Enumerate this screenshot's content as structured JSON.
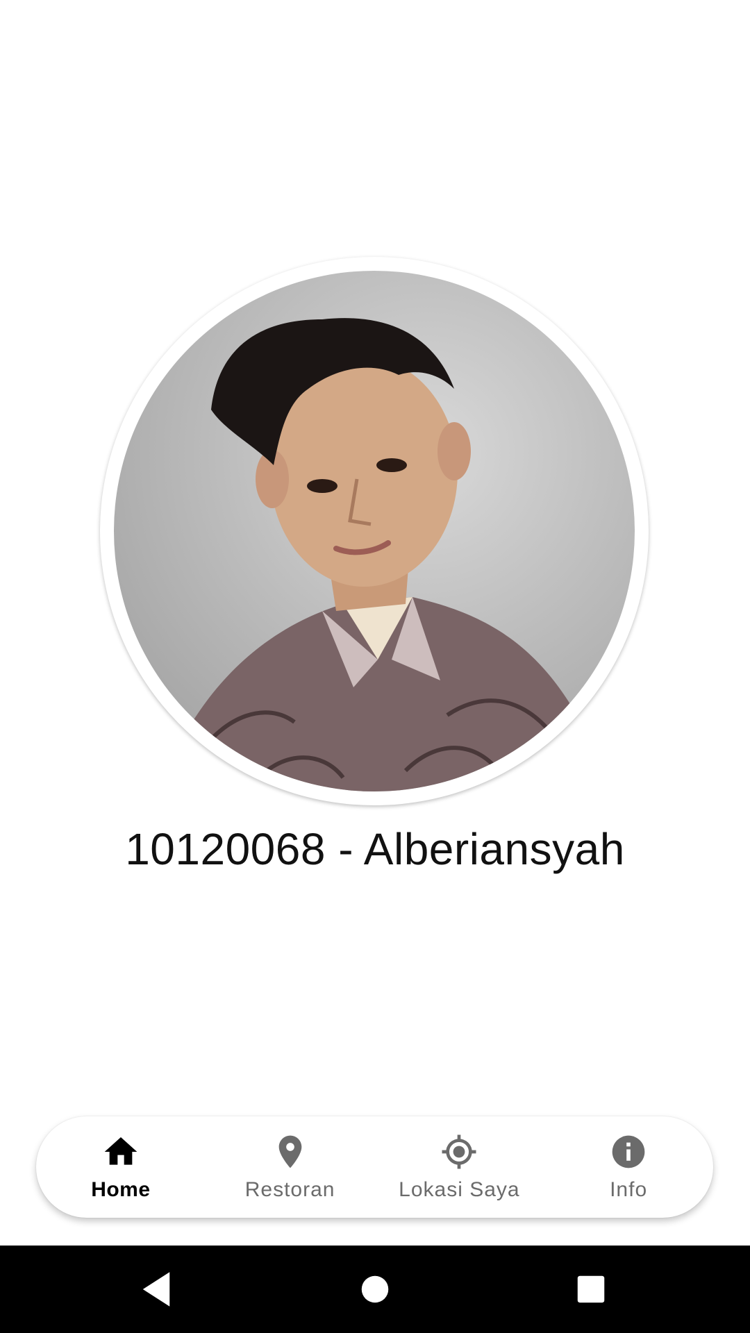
{
  "profile": {
    "name": "10120068 - Alberiansyah",
    "photo_icon": "profile-photo"
  },
  "bottom_nav": {
    "items": [
      {
        "label": "Home",
        "icon": "home-icon",
        "active": true
      },
      {
        "label": "Restoran",
        "icon": "location-pin-icon",
        "active": false
      },
      {
        "label": "Lokasi Saya",
        "icon": "my-location-icon",
        "active": false
      },
      {
        "label": "Info",
        "icon": "info-icon",
        "active": false
      }
    ],
    "active_color": "#000000",
    "inactive_color": "#6b6b6b"
  },
  "system_nav": {
    "buttons": [
      "back-icon",
      "home-circle-icon",
      "recents-icon"
    ]
  }
}
